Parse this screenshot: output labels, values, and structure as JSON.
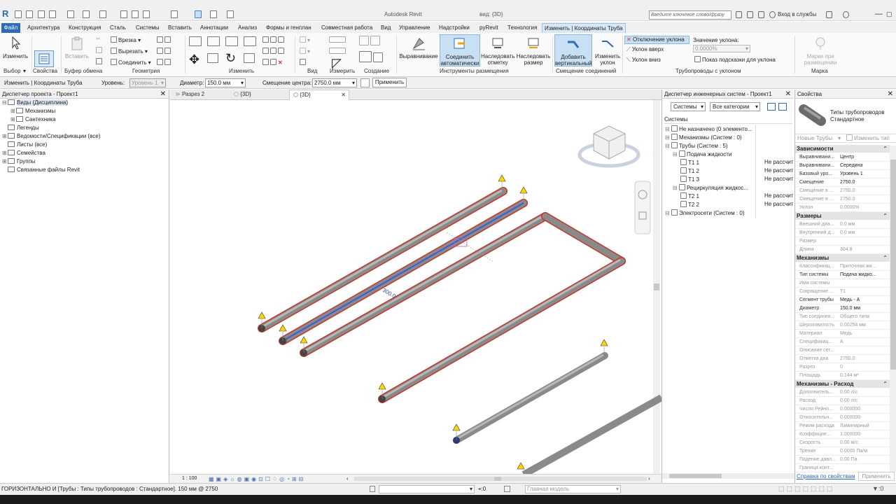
{
  "title_bar": {
    "app_title": "Autodesk Revit",
    "view_label": "вид: {3D}",
    "search_placeholder": "Введите ключевое слово/фразу",
    "sign_in": "Вход в службы"
  },
  "ribbon_tabs": [
    "Файл",
    "Архитектура",
    "Конструкция",
    "Сталь",
    "Системы",
    "Вставить",
    "Аннотации",
    "Анализ",
    "Формы и генплан",
    "Совместная работа",
    "Вид",
    "Управление",
    "Надстройки",
    "pyRevit",
    "Технология",
    "Изменить | Координаты Труба"
  ],
  "ribbon": {
    "modify": "Изменить",
    "paste": "Вставить",
    "properties": "Свойства",
    "cut_in": "Врезка",
    "cut": "Вырезать",
    "join": "Соединить",
    "align": "Выравнивание",
    "auto_connect": "Соединить автоматически",
    "inherit_elevation": "Наследовать отметку",
    "inherit_size": "Наследовать размер",
    "add_vertical": "Добавить вертикальный",
    "change_slope": "Изменить уклон",
    "slope_off": "Отключение уклона",
    "slope_up": "Уклон вверх",
    "slope_down": "Уклон вниз",
    "slope_value_label": "Значение уклона:",
    "slope_value": "0.0000%",
    "show_slope_tooltips": "Показ подсказки для уклона",
    "tags_on_placement": "Марки при размещении",
    "panels": {
      "select": "Выбор",
      "properties": "Свойства",
      "clipboard": "Буфер обмена",
      "geometry": "Геометрия",
      "modify": "Изменить",
      "view": "Вид",
      "measure": "Измерить",
      "create": "Создание",
      "placement_tools": "Инструменты размещения",
      "offset_connections": "Смещение соединений",
      "sloped_piping": "Трубопроводы с уклоном",
      "tag": "Марка"
    }
  },
  "options_bar": {
    "context": "Изменить | Координаты Труба",
    "level_label": "Уровень:",
    "level_value": "Уровень 1",
    "diameter_label": "Диаметр:",
    "diameter_value": "150.0 мм",
    "offset_label": "Смещение центра:",
    "offset_value": "2750.0 мм",
    "apply": "Применить"
  },
  "project_browser": {
    "title": "Диспетчер проекта - Проект1",
    "items": [
      {
        "label": "Виды (Дисциплина)",
        "level": 0,
        "toggle": "⊟"
      },
      {
        "label": "Механизмы",
        "level": 1,
        "toggle": "⊞"
      },
      {
        "label": "Сантехника",
        "level": 1,
        "toggle": "⊞"
      },
      {
        "label": "Легенды",
        "level": 0,
        "toggle": ""
      },
      {
        "label": "Ведомости/Спецификации (все)",
        "level": 0,
        "toggle": "⊞"
      },
      {
        "label": "Листы (все)",
        "level": 0,
        "toggle": ""
      },
      {
        "label": "Семейства",
        "level": 0,
        "toggle": "⊞"
      },
      {
        "label": "Группы",
        "level": 0,
        "toggle": "⊞"
      },
      {
        "label": "Связанные файлы Revit",
        "level": 0,
        "toggle": ""
      }
    ]
  },
  "view_tabs": [
    {
      "label": "Разрез 2",
      "active": false
    },
    {
      "label": "{3D}",
      "active": false
    },
    {
      "label": "{3D}",
      "active": true
    }
  ],
  "canvas": {
    "dimension_label": "300.0",
    "scale": "1 : 100"
  },
  "system_browser": {
    "title": "Диспетчер инженерных систем - Проект1",
    "filter_systems": "Системы",
    "filter_categories": "Все категории",
    "header": "Системы",
    "rows": [
      {
        "label": "Не назначено (0 элементо...",
        "level": 0,
        "calc": ""
      },
      {
        "label": "Механизмы (Систем : 0)",
        "level": 0,
        "calc": ""
      },
      {
        "label": "Трубы (Систем : 5)",
        "level": 0,
        "calc": ""
      },
      {
        "label": "Подача жидкости",
        "level": 1,
        "calc": ""
      },
      {
        "label": "T1 1",
        "level": 2,
        "calc": "Не рассчит"
      },
      {
        "label": "T1 2",
        "level": 2,
        "calc": "Не рассчит"
      },
      {
        "label": "T1 3",
        "level": 2,
        "calc": "Не рассчит"
      },
      {
        "label": "Рециркуляция жидкос...",
        "level": 1,
        "calc": ""
      },
      {
        "label": "T2 1",
        "level": 2,
        "calc": "Не рассчит"
      },
      {
        "label": "T2 2",
        "level": 2,
        "calc": "Не рассчит"
      },
      {
        "label": "Электросети (Систем : 0)",
        "level": 0,
        "calc": ""
      }
    ]
  },
  "properties": {
    "title": "Свойства",
    "type_name": "Типы трубопроводов Стандартное",
    "new_type": "Новые Трубы",
    "edit_type": "Изменить тип",
    "sections": [
      {
        "name": "Зависимости",
        "rows": [
          {
            "k": "Выравнивани...",
            "v": "Центр",
            "dim": false
          },
          {
            "k": "Выравнивани...",
            "v": "Середина",
            "dim": false
          },
          {
            "k": "Базовый уро...",
            "v": "Уровень 1",
            "dim": false
          },
          {
            "k": "Смещение",
            "v": "2750.0",
            "dim": false
          },
          {
            "k": "Смещение в ...",
            "v": "2750.0",
            "dim": true
          },
          {
            "k": "Смещение в ...",
            "v": "2750.0",
            "dim": true
          },
          {
            "k": "Уклон",
            "v": "0.0000%",
            "dim": true
          }
        ]
      },
      {
        "name": "Размеры",
        "rows": [
          {
            "k": "Внешний диа...",
            "v": "0.0 мм",
            "dim": true
          },
          {
            "k": "Внутренний д...",
            "v": "0.0 мм",
            "dim": true
          },
          {
            "k": "Размер",
            "v": "",
            "dim": true
          },
          {
            "k": "Длина",
            "v": "304.8",
            "dim": true
          }
        ]
      },
      {
        "name": "Механизмы",
        "rows": [
          {
            "k": "Классификац...",
            "v": "Приточная жи...",
            "dim": true
          },
          {
            "k": "Тип системы",
            "v": "Подача жидко...",
            "dim": false
          },
          {
            "k": "Имя системы",
            "v": "",
            "dim": true
          },
          {
            "k": "Сокращение ...",
            "v": "T1",
            "dim": true
          },
          {
            "k": "Сегмент трубы",
            "v": "Медь - A",
            "dim": false
          },
          {
            "k": "Диаметр",
            "v": "150.0 мм",
            "dim": false
          },
          {
            "k": "Тип соединен...",
            "v": "Общего типа",
            "dim": true
          },
          {
            "k": "Шероховатость",
            "v": "0.00254 мм",
            "dim": true
          },
          {
            "k": "Материал",
            "v": "Медь",
            "dim": true
          },
          {
            "k": "Спецификац...",
            "v": "A",
            "dim": true
          },
          {
            "k": "Описание сег...",
            "v": "",
            "dim": true
          },
          {
            "k": "Отметка дна",
            "v": "2750.0",
            "dim": true
          },
          {
            "k": "Разрез",
            "v": "0",
            "dim": true
          },
          {
            "k": "Площадь",
            "v": "0.144 м²",
            "dim": true
          }
        ]
      },
      {
        "name": "Механизмы - Расход",
        "rows": [
          {
            "k": "Дополнитель...",
            "v": "0.00 л/с",
            "dim": true
          },
          {
            "k": "Расход",
            "v": "0.00 л/с",
            "dim": true
          },
          {
            "k": "Число Рейно...",
            "v": "0.000000",
            "dim": true
          },
          {
            "k": "Относительн...",
            "v": "0.000000",
            "dim": true
          },
          {
            "k": "Режим расхода",
            "v": "Ламинарный",
            "dim": true
          },
          {
            "k": "Коэффицие...",
            "v": "1.000000",
            "dim": true
          },
          {
            "k": "Скорость",
            "v": "0.00 м/с",
            "dim": true
          },
          {
            "k": "Трение",
            "v": "0.0000 Па/м",
            "dim": true
          },
          {
            "k": "Падение давл...",
            "v": "0.00 Па",
            "dim": true
          },
          {
            "k": "Граница конт...",
            "v": "",
            "dim": true
          }
        ]
      }
    ],
    "help_link": "Справка по свойствам",
    "apply": "Применить"
  },
  "status_bar": {
    "text": "ГОРИЗОНТАЛЬНО И [Трубы : Типы трубопроводов : Стандартное]. 150 мм @ 2750",
    "zero": ":0",
    "model": "Главная модель"
  },
  "colors": {
    "file_tab": "#2d6bb5",
    "active_tab": "#d9e8f7",
    "pipe": "#8a8a8a",
    "pipe_edge": "#c0392b",
    "pipe_selected": "#3b5bdb"
  }
}
